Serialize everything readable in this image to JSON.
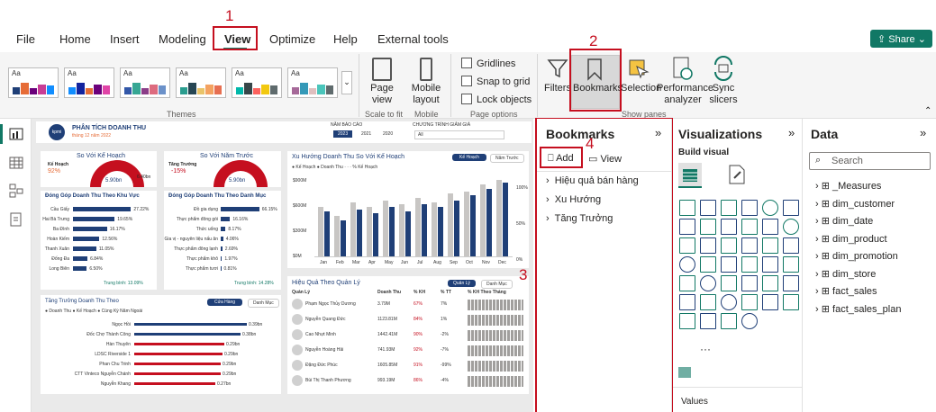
{
  "menu": {
    "file": "File",
    "home": "Home",
    "insert": "Insert",
    "modeling": "Modeling",
    "view": "View",
    "optimize": "Optimize",
    "help": "Help",
    "external": "External tools",
    "share": "Share"
  },
  "ribbon": {
    "theme_thumb": "Aa",
    "themes_group": "Themes",
    "page_view": "Page view",
    "scale_group": "Scale to fit",
    "mobile_layout": "Mobile layout",
    "mobile_group": "Mobile",
    "gridlines": "Gridlines",
    "snap": "Snap to grid",
    "lock": "Lock objects",
    "page_options": "Page options",
    "filters": "Filters",
    "bookmarks": "Bookmarks",
    "selection": "Selection",
    "performance": "Performance analyzer",
    "sync": "Sync slicers",
    "show_panes": "Show panes"
  },
  "annotations": [
    "1",
    "2",
    "3",
    "4"
  ],
  "report": {
    "logo": "kpmi",
    "title": "PHÂN TÍCH DOANH THU",
    "subtitle": "tháng 12 năm 2022",
    "year_label": "NĂM BÁO CÁO",
    "years": [
      "2023",
      "2021",
      "2020"
    ],
    "program_label": "CHƯƠNG TRÌNH GIẢM GIÁ",
    "program_value": "All",
    "kpi1": {
      "title": "So Với Kế Hoạch",
      "label": "Kế Hoạch",
      "pct": "92%",
      "value": "5.90bn",
      "target": "6.40bn"
    },
    "kpi2": {
      "title": "So Với Năm Trước",
      "label": "Tăng Trưởng",
      "pct": "-15%",
      "value": "5.90bn"
    },
    "region": {
      "title": "Đóng Góp Doanh Thu Theo Khu Vực",
      "rows": [
        {
          "n": "Cầu Giấy",
          "v": "27.22%",
          "w": 92
        },
        {
          "n": "Hai Bà Trưng",
          "v": "19.65%",
          "w": 66
        },
        {
          "n": "Ba Đình",
          "v": "16.17%",
          "w": 54
        },
        {
          "n": "Hoàn Kiếm",
          "v": "12.56%",
          "w": 42
        },
        {
          "n": "Thanh Xuân",
          "v": "11.05%",
          "w": 37
        },
        {
          "n": "Đống Đa",
          "v": "6.84%",
          "w": 23
        },
        {
          "n": "Long Biên",
          "v": "6.50%",
          "w": 22
        }
      ],
      "avg": "Trung bình: 13.09%"
    },
    "category": {
      "title": "Đóng Góp Doanh Thu Theo Danh Mục",
      "rows": [
        {
          "n": "Đồ gia dụng",
          "v": "66.15%",
          "w": 95
        },
        {
          "n": "Thực phẩm đông gói",
          "v": "16.16%",
          "w": 23
        },
        {
          "n": "Thức uống",
          "v": "8.17%",
          "w": 12
        },
        {
          "n": "Gia vị - nguyên liệu nấu ăn",
          "v": "4.06%",
          "w": 6
        },
        {
          "n": "Thực phẩm đông lạnh",
          "v": "2.69%",
          "w": 4
        },
        {
          "n": "Thực phẩm khô",
          "v": "1.97%",
          "w": 3
        },
        {
          "n": "Thực phẩm tươi",
          "v": "0.81%",
          "w": 1
        }
      ],
      "avg": "Trung bình: 14.28%"
    },
    "trend": {
      "title": "Xu Hướng Doanh Thu So Với Kế Hoạch",
      "tab1": "Kế Hoạch",
      "tab2": "Năm Trước",
      "legend": "● Kế Hoạch ● Doanh Thu · · · % Kế Hoạch",
      "months": [
        "Jan",
        "Feb",
        "Mar",
        "Apr",
        "May",
        "Jun",
        "Jul",
        "Aug",
        "Sep",
        "Oct",
        "Nov",
        "Dec"
      ],
      "y_left": [
        "$900M",
        "$600M",
        "$300M",
        "$0M"
      ],
      "y_right": [
        "100%",
        "50%",
        "0%"
      ]
    },
    "growth": {
      "title": "Tăng Trưởng Doanh Thu Theo",
      "tab1": "Cửa Hàng",
      "tab2": "Danh Mục",
      "legend": "● Doanh Thu ● Kế Hoạch ● Cùng Kỳ Năm Ngoái",
      "rows": [
        {
          "n": "Ngọc Hồi",
          "v": "0.39bn"
        },
        {
          "n": "Đốc Chợ Thành Công",
          "v": "0.38bn"
        },
        {
          "n": "Hàn Thuyên",
          "v": "0.29bn"
        },
        {
          "n": "LDSC Riverside 1",
          "v": "0.29bn"
        },
        {
          "n": "Phan Chu Trinh",
          "v": "0.29bn"
        },
        {
          "n": "CTT Vinteco Nguyễn Chánh",
          "v": "0.29bn"
        },
        {
          "n": "Nguyễn Khang",
          "v": "0.27bn"
        }
      ]
    },
    "managers": {
      "title": "Hiệu Quả Theo Quản Lý",
      "tab1": "Quản Lý",
      "tab2": "Danh Mục",
      "cols": [
        "Quản Lý",
        "Doanh Thu",
        "% KH",
        "% TT",
        "% KH Theo Tháng"
      ],
      "rows": [
        {
          "n": "Phạm Ngọc Thủy Dương",
          "r": "3.79M",
          "k": "67%",
          "t": "7%"
        },
        {
          "n": "Nguyễn Quang Đức",
          "r": "1123.81M",
          "k": "84%",
          "t": "1%"
        },
        {
          "n": "Cao Nhựt Minh",
          "r": "1442.41M",
          "k": "90%",
          "t": "-2%"
        },
        {
          "n": "Nguyễn Hoàng Hải",
          "r": "741.93M",
          "k": "92%",
          "t": "-7%"
        },
        {
          "n": "Đặng Đức Phúc",
          "r": "1605.85M",
          "k": "91%",
          "t": "-99%"
        },
        {
          "n": "Bùi Thị Thanh Phương",
          "r": "993.19M",
          "k": "86%",
          "t": "-4%"
        }
      ]
    }
  },
  "bookmarks": {
    "title": "Bookmarks",
    "add": "Add",
    "view": "View",
    "items": [
      "Hiệu quả bán hàng",
      "Xu Hướng",
      "Tăng Trưởng"
    ]
  },
  "visualizations": {
    "title": "Visualizations",
    "build": "Build visual",
    "values": "Values",
    "more": "···"
  },
  "data": {
    "title": "Data",
    "search_placeholder": "Search",
    "items": [
      "_Measures",
      "dim_customer",
      "dim_date",
      "dim_product",
      "dim_promotion",
      "dim_store",
      "fact_sales",
      "fact_sales_plan"
    ]
  }
}
